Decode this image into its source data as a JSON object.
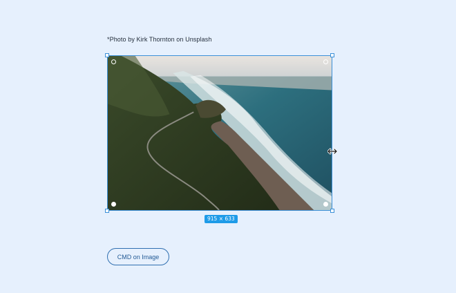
{
  "caption": "*Photo by Kirk Thornton on Unsplash",
  "image": {
    "alt": "Aerial view of coastal cliffs with a winding road and ocean waves",
    "size_label": "915 × 633"
  },
  "button": {
    "label": "CMD on Image"
  },
  "colors": {
    "background": "#e6f0fd",
    "selection": "#3a8fd8",
    "badge": "#1e9be8",
    "button_text": "#245b96"
  }
}
